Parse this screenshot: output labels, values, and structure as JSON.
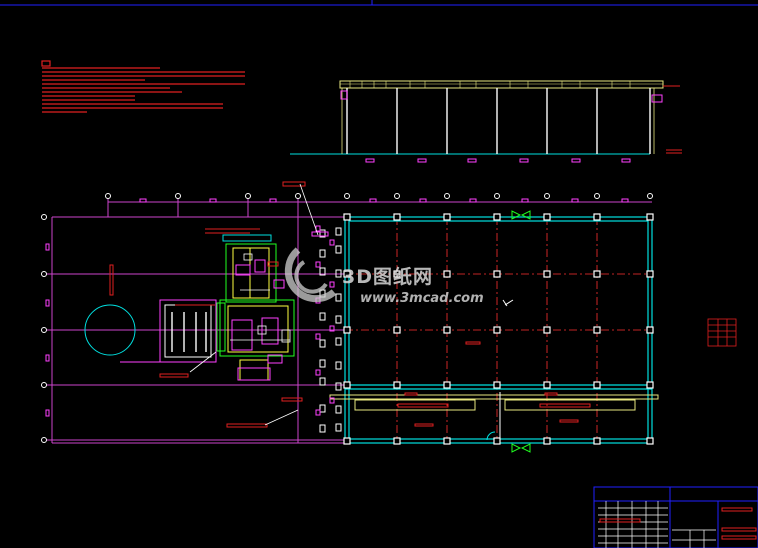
{
  "watermark": {
    "logo_text": "3D图纸网",
    "url_text": "www.3mcad.com"
  },
  "colors": {
    "background": "#000000",
    "axis_grid": "#cc44cc",
    "building_outline": "#00e0e0",
    "columns": "#ffffff",
    "elevation_yellow": "#e8e880",
    "note_red": "#e02020",
    "equipment_green": "#20ff20",
    "equipment_yellow": "#ffff40",
    "equipment_magenta": "#ff40ff",
    "centerline_red": "#ff3030",
    "title_block_blue": "#2020ff",
    "watermark": "#d8d8d8"
  }
}
